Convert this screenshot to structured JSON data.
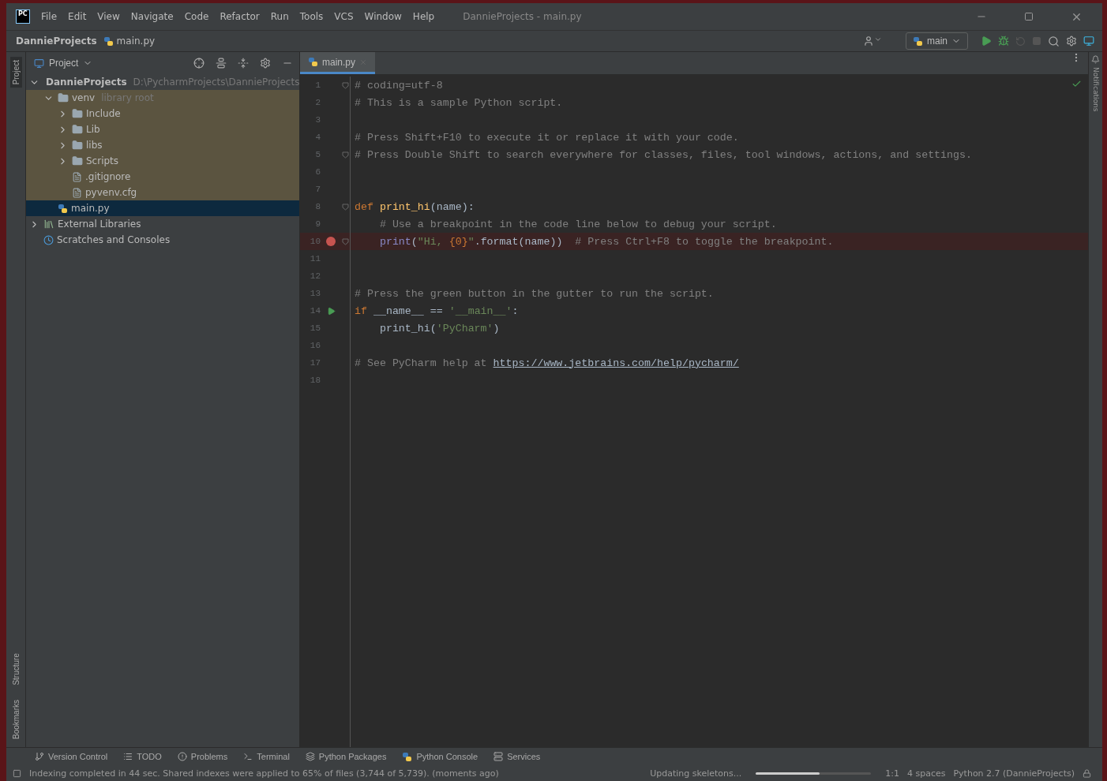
{
  "window": {
    "logo_text": "PC",
    "title": "DannieProjects - main.py"
  },
  "menu": [
    "File",
    "Edit",
    "View",
    "Navigate",
    "Code",
    "Refactor",
    "Run",
    "Tools",
    "VCS",
    "Window",
    "Help"
  ],
  "breadcrumbs": [
    {
      "text": "DannieProjects",
      "kind": "folder"
    },
    {
      "text": "main.py",
      "kind": "python"
    }
  ],
  "run_config": {
    "label": "main"
  },
  "left_stripe": {
    "top": [
      {
        "label": "Project",
        "selected": true
      }
    ],
    "bottom": [
      {
        "label": "Structure",
        "selected": false
      },
      {
        "label": "Bookmarks",
        "selected": false
      }
    ]
  },
  "right_stripe": [
    {
      "label": "Notifications"
    }
  ],
  "project_panel": {
    "title": "Project",
    "tree": [
      {
        "name": "DannieProjects",
        "hint": "D:\\PycharmProjects\\DannieProjects",
        "kind": "folder",
        "expanded": true,
        "selected": false,
        "children": [
          {
            "name": "venv",
            "hint": "library root",
            "kind": "folder",
            "library": true,
            "expanded": true,
            "selected": false,
            "children": [
              {
                "name": "Include",
                "kind": "folder",
                "expanded": false,
                "selected": false
              },
              {
                "name": "Lib",
                "kind": "folder",
                "expanded": false,
                "selected": false
              },
              {
                "name": "libs",
                "kind": "folder",
                "expanded": false,
                "selected": false
              },
              {
                "name": "Scripts",
                "kind": "folder",
                "expanded": false,
                "selected": false
              },
              {
                "name": ".gitignore",
                "kind": "file",
                "selected": false
              },
              {
                "name": "pyvenv.cfg",
                "kind": "file",
                "selected": false
              }
            ]
          },
          {
            "name": "main.py",
            "kind": "python",
            "selected": true
          }
        ]
      },
      {
        "name": "External Libraries",
        "kind": "libraries",
        "expanded": false,
        "selected": false
      },
      {
        "name": "Scratches and Consoles",
        "kind": "scratches",
        "selected": false
      }
    ]
  },
  "editor": {
    "tabs": [
      {
        "label": "main.py",
        "selected": true
      }
    ],
    "lines": [
      {
        "number": "1",
        "fold": true,
        "tokens": [
          {
            "kind": "comment",
            "text": "# coding=utf-8"
          }
        ]
      },
      {
        "number": "2",
        "tokens": [
          {
            "kind": "comment",
            "text": "# This is a sample Python script."
          }
        ]
      },
      {
        "number": "3"
      },
      {
        "number": "4",
        "tokens": [
          {
            "kind": "comment",
            "text": "# Press Shift+F10 to execute it or replace it with your code."
          }
        ]
      },
      {
        "number": "5",
        "fold": true,
        "tokens": [
          {
            "kind": "comment",
            "text": "# Press Double Shift to search everywhere for classes, files, tool windows, actions, and settings."
          }
        ]
      },
      {
        "number": "6"
      },
      {
        "number": "7"
      },
      {
        "number": "8",
        "fold": true,
        "tokens": [
          {
            "kind": "keyword",
            "text": "def "
          },
          {
            "kind": "function",
            "text": "print_hi"
          },
          {
            "kind": "plain",
            "text": "(name):"
          }
        ]
      },
      {
        "number": "9",
        "tokens": [
          {
            "kind": "comment",
            "text": "    # Use a breakpoint in the code line below to debug your script."
          }
        ]
      },
      {
        "number": "10",
        "fold": true,
        "breakpoint": true,
        "tokens": [
          {
            "kind": "builtin",
            "text": "    print"
          },
          {
            "kind": "plain",
            "text": "("
          },
          {
            "kind": "string",
            "text": "\"Hi, "
          },
          {
            "kind": "format",
            "text": "{0}"
          },
          {
            "kind": "string",
            "text": "\""
          },
          {
            "kind": "plain",
            "text": ".format(name))  "
          },
          {
            "kind": "comment",
            "text": "# Press Ctrl+F8 to toggle the breakpoint."
          }
        ]
      },
      {
        "number": "11"
      },
      {
        "number": "12"
      },
      {
        "number": "13",
        "tokens": [
          {
            "kind": "comment",
            "text": "# Press the green button in the gutter to run the script."
          }
        ]
      },
      {
        "number": "14",
        "run": true,
        "tokens": [
          {
            "kind": "keyword",
            "text": "if "
          },
          {
            "kind": "plain",
            "text": "__name__ == "
          },
          {
            "kind": "string",
            "text": "'__main__'"
          },
          {
            "kind": "plain",
            "text": ":"
          }
        ]
      },
      {
        "number": "15",
        "tokens": [
          {
            "kind": "plain",
            "text": "    print_hi("
          },
          {
            "kind": "string",
            "text": "'PyCharm'"
          },
          {
            "kind": "plain",
            "text": ")"
          }
        ]
      },
      {
        "number": "16"
      },
      {
        "number": "17",
        "tokens": [
          {
            "kind": "comment",
            "text": "# See PyCharm help at "
          },
          {
            "kind": "link",
            "text": "https://www.jetbrains.com/help/pycharm/"
          }
        ]
      },
      {
        "number": "18"
      }
    ]
  },
  "tool_windows": [
    {
      "label": "Version Control",
      "kind": "vcs"
    },
    {
      "label": "TODO",
      "kind": "todo"
    },
    {
      "label": "Problems",
      "kind": "problems"
    },
    {
      "label": "Terminal",
      "kind": "terminal"
    },
    {
      "label": "Python Packages",
      "kind": "packages"
    },
    {
      "label": "Python Console",
      "kind": "console"
    },
    {
      "label": "Services",
      "kind": "services"
    }
  ],
  "status_bar": {
    "message": "Indexing completed in 44 sec. Shared indexes were applied to 65% of files (3,744 of 5,739). (moments ago)",
    "task": "Updating skeletons...",
    "progress": {
      "level": 0.55
    },
    "position": "1:1",
    "indent": "4 spaces",
    "interpreter": "Python 2.7 (DannieProjects)"
  }
}
